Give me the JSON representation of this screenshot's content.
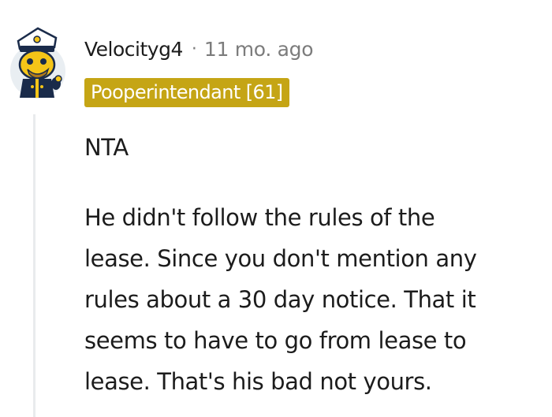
{
  "comment": {
    "username": "Velocityg4",
    "separator": "·",
    "timestamp": "11 mo. ago",
    "flair": "Pooperintendant [61]",
    "paragraphs": [
      "NTA"
    ],
    "lines": [
      "He didn't follow the rules of the",
      "lease. Since you don't mention any",
      "rules about a 30 day notice. That it",
      "seems to have to go from lease to",
      "lease. That's his bad not yours."
    ]
  },
  "colors": {
    "flair_bg": "#c5a515",
    "flair_text": "#ffffff",
    "avatar_bg": "#e9eef2",
    "avatar_face": "#f5c518",
    "thread_line": "#e9ebed"
  },
  "icons": {
    "avatar": "snoo-captain-avatar"
  }
}
